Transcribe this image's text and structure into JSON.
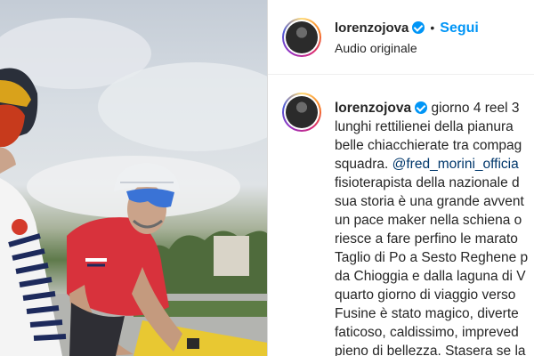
{
  "post": {
    "username": "lorenzojova",
    "verified": true,
    "follow_label": "Segui",
    "separator": "•",
    "audio_label": "Audio originale"
  },
  "caption": {
    "username": "lorenzojova",
    "first_line_text": "giorno 4 reel 3",
    "lines": [
      "lunghi rettilienei della pianura",
      "belle chiacchierate tra compag",
      "fisioterapista della nazionale d",
      "sua storia è una grande avvent",
      "un pace maker nella schiena o",
      "riesce a fare perfino le marato",
      "Taglio di Po a Sesto Reghene p",
      "da Chioggia e dalla laguna di V",
      "quarto giorno di viaggio verso",
      "Fusine è stato magico, diverte",
      "faticoso, caldissimo, impreved",
      "pieno di bellezza. Stasera se la"
    ],
    "squadra_text": "squadra. ",
    "mention": "@fred_morini_officia"
  },
  "colors": {
    "accent": "#0095f6",
    "mention": "#00376b",
    "text": "#262626"
  }
}
